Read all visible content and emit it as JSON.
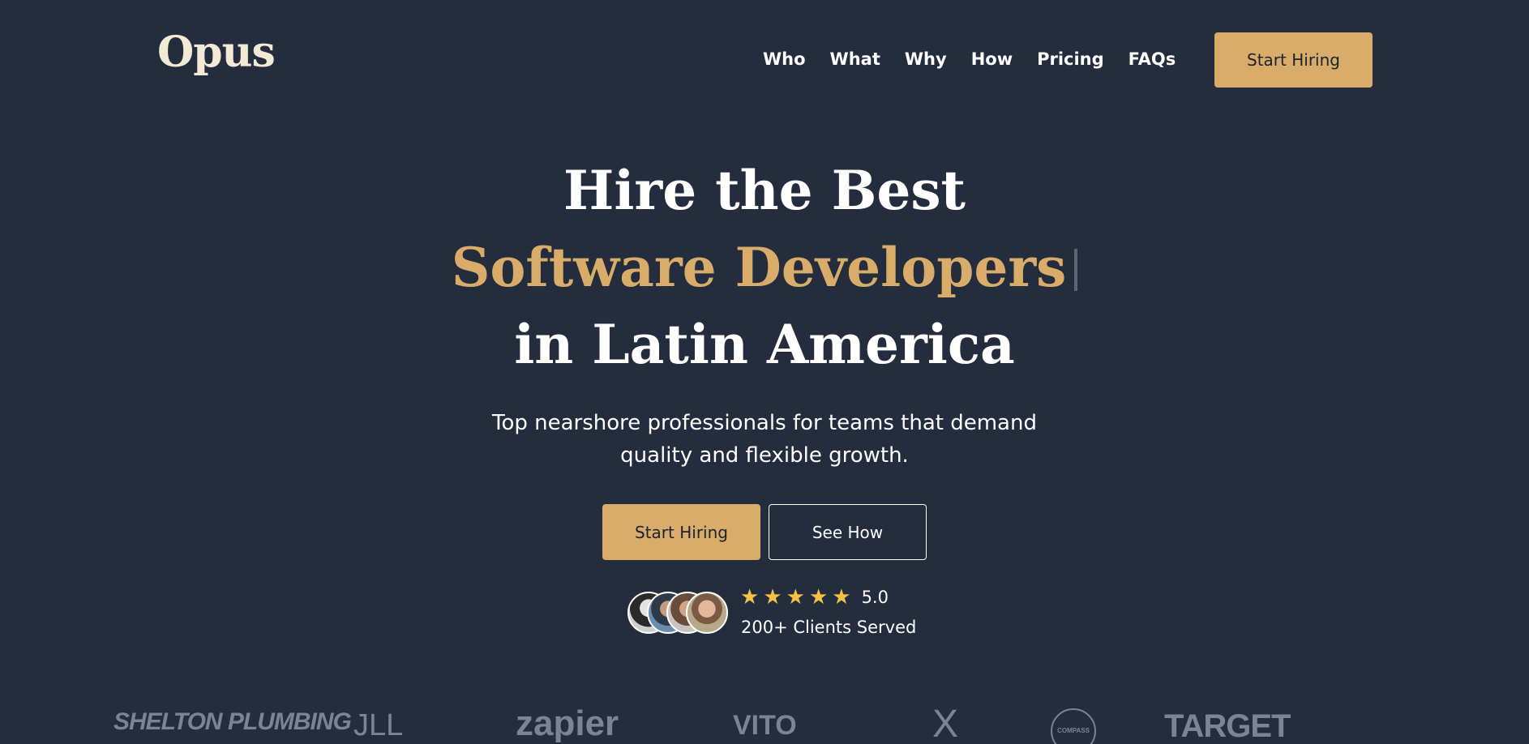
{
  "header": {
    "logo": "Opus",
    "nav": [
      "Who",
      "What",
      "Why",
      "How",
      "Pricing",
      "FAQs"
    ],
    "cta_label": "Start Hiring"
  },
  "hero": {
    "line1": "Hire the Best",
    "line2": "Software Developers",
    "line3": "in Latin America",
    "subtitle": "Top nearshore professionals for teams that demand quality and flexible growth.",
    "primary_cta": "Start Hiring",
    "secondary_cta": "See How"
  },
  "social_proof": {
    "stars": 5,
    "rating": "5.0",
    "clients": "200+ Clients Served"
  },
  "client_logos": [
    "SHELTON PLUMBING",
    "JLL",
    "zapier",
    "VITO",
    "X",
    "COMPASS",
    "TARGET"
  ],
  "colors": {
    "background": "#242d3d",
    "accent": "#d9ad69",
    "star": "#f5c043",
    "logo_text": "#f3ead6"
  }
}
